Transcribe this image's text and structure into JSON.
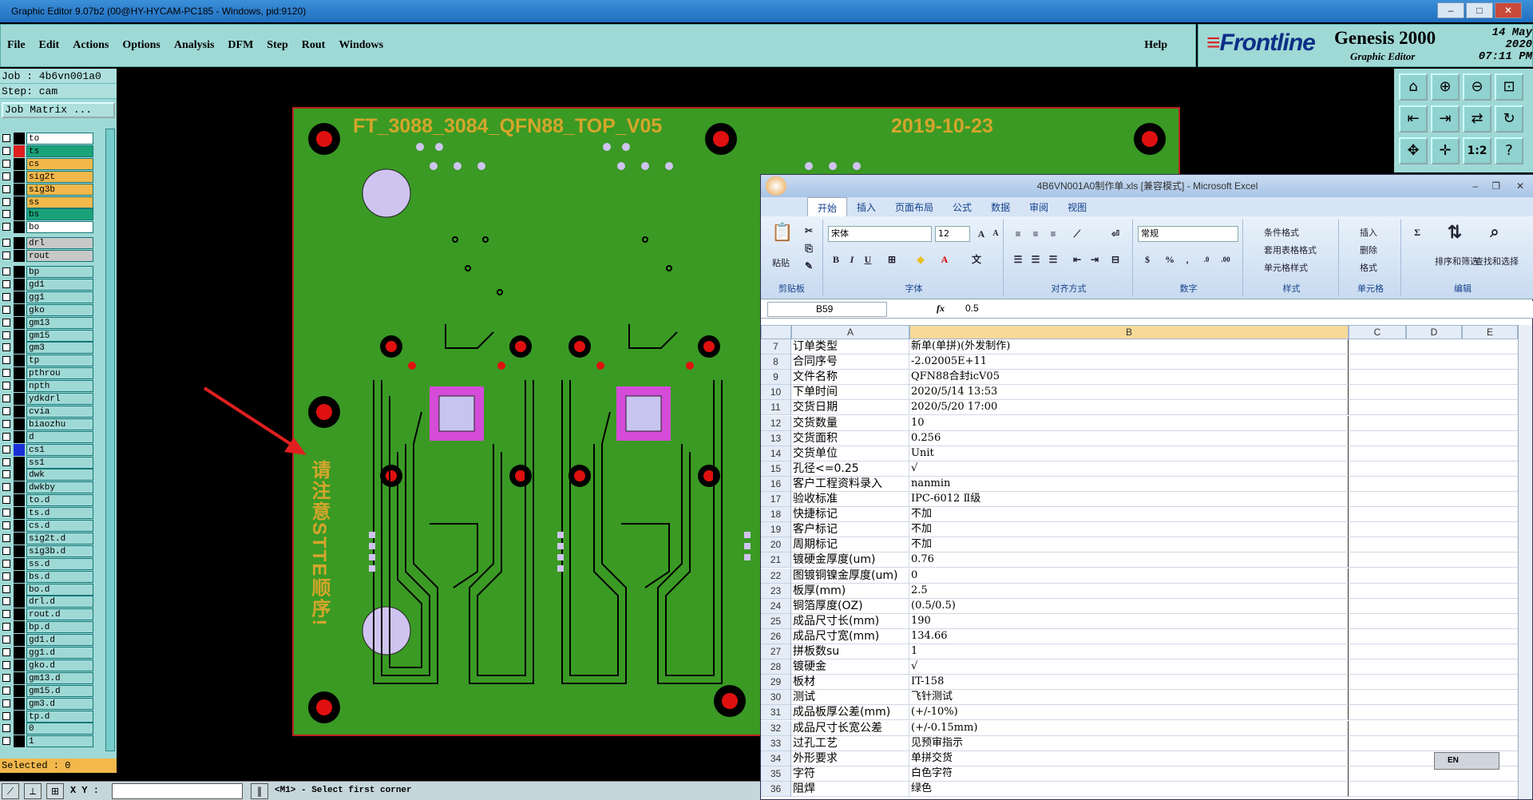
{
  "window_title": "Graphic Editor 9.07b2 (00@HY-HYCAM-PC185 - Windows, pid:9120)",
  "menu": {
    "items": [
      "File",
      "Edit",
      "Actions",
      "Options",
      "Analysis",
      "DFM",
      "Step",
      "Rout",
      "Windows"
    ],
    "help": "Help"
  },
  "brand": {
    "logo": "Frontline",
    "product": "Genesis 2000",
    "subtitle": "Graphic Editor",
    "date": "14 May 2020",
    "time": "07:11 PM"
  },
  "left": {
    "job": "Job : 4b6vn001a0",
    "step": "Step: cam",
    "job_matrix": "Job Matrix ...",
    "selected": "Selected : 0",
    "layers": [
      {
        "name": "to",
        "color": "#ffffff",
        "swatch": "#000000"
      },
      {
        "name": "ts",
        "color": "#1aa37a",
        "swatch": "#e02020"
      },
      {
        "name": "cs",
        "color": "#f2b84b",
        "swatch": "#000000"
      },
      {
        "name": "sig2t",
        "color": "#f2b84b",
        "swatch": "#000000"
      },
      {
        "name": "sig3b",
        "color": "#f2b84b",
        "swatch": "#000000"
      },
      {
        "name": "ss",
        "color": "#f2b84b",
        "swatch": "#000000"
      },
      {
        "name": "bs",
        "color": "#1aa37a",
        "swatch": "#000000"
      },
      {
        "name": "bo",
        "color": "#ffffff",
        "swatch": "#000000"
      },
      {
        "name": "drl",
        "color": "#c8c8c8",
        "swatch": "#000000"
      },
      {
        "name": "rout",
        "color": "#c8c8c8",
        "swatch": "#000000"
      },
      {
        "name": "bp",
        "color": "#9fd9d6",
        "swatch": "#000000"
      },
      {
        "name": "gd1",
        "color": "#9fd9d6",
        "swatch": "#000000"
      },
      {
        "name": "gg1",
        "color": "#9fd9d6",
        "swatch": "#000000"
      },
      {
        "name": "gko",
        "color": "#9fd9d6",
        "swatch": "#000000"
      },
      {
        "name": "gm13",
        "color": "#9fd9d6",
        "swatch": "#000000"
      },
      {
        "name": "gm15",
        "color": "#9fd9d6",
        "swatch": "#000000"
      },
      {
        "name": "gm3",
        "color": "#9fd9d6",
        "swatch": "#000000"
      },
      {
        "name": "tp",
        "color": "#9fd9d6",
        "swatch": "#000000"
      },
      {
        "name": "pthrou",
        "color": "#9fd9d6",
        "swatch": "#000000"
      },
      {
        "name": "npth",
        "color": "#9fd9d6",
        "swatch": "#000000"
      },
      {
        "name": "ydkdrl",
        "color": "#9fd9d6",
        "swatch": "#000000"
      },
      {
        "name": "cvia",
        "color": "#9fd9d6",
        "swatch": "#000000"
      },
      {
        "name": "biaozhu",
        "color": "#9fd9d6",
        "swatch": "#000000"
      },
      {
        "name": "d",
        "color": "#9fd9d6",
        "swatch": "#000000"
      },
      {
        "name": "cs1",
        "color": "#9fd9d6",
        "swatch": "#1a2fd8"
      },
      {
        "name": "ss1",
        "color": "#9fd9d6",
        "swatch": "#000000"
      },
      {
        "name": "dwk",
        "color": "#9fd9d6",
        "swatch": "#000000"
      },
      {
        "name": "dwkby",
        "color": "#9fd9d6",
        "swatch": "#000000"
      },
      {
        "name": "to.d",
        "color": "#9fd9d6",
        "swatch": "#000000"
      },
      {
        "name": "ts.d",
        "color": "#9fd9d6",
        "swatch": "#000000"
      },
      {
        "name": "cs.d",
        "color": "#9fd9d6",
        "swatch": "#000000"
      },
      {
        "name": "sig2t.d",
        "color": "#9fd9d6",
        "swatch": "#000000"
      },
      {
        "name": "sig3b.d",
        "color": "#9fd9d6",
        "swatch": "#000000"
      },
      {
        "name": "ss.d",
        "color": "#9fd9d6",
        "swatch": "#000000"
      },
      {
        "name": "bs.d",
        "color": "#9fd9d6",
        "swatch": "#000000"
      },
      {
        "name": "bo.d",
        "color": "#9fd9d6",
        "swatch": "#000000"
      },
      {
        "name": "drl.d",
        "color": "#9fd9d6",
        "swatch": "#000000"
      },
      {
        "name": "rout.d",
        "color": "#9fd9d6",
        "swatch": "#000000"
      },
      {
        "name": "bp.d",
        "color": "#9fd9d6",
        "swatch": "#000000"
      },
      {
        "name": "gd1.d",
        "color": "#9fd9d6",
        "swatch": "#000000"
      },
      {
        "name": "gg1.d",
        "color": "#9fd9d6",
        "swatch": "#000000"
      },
      {
        "name": "gko.d",
        "color": "#9fd9d6",
        "swatch": "#000000"
      },
      {
        "name": "gm13.d",
        "color": "#9fd9d6",
        "swatch": "#000000"
      },
      {
        "name": "gm15.d",
        "color": "#9fd9d6",
        "swatch": "#000000"
      },
      {
        "name": "gm3.d",
        "color": "#9fd9d6",
        "swatch": "#000000"
      },
      {
        "name": "tp.d",
        "color": "#9fd9d6",
        "swatch": "#000000"
      },
      {
        "name": "0",
        "color": "#9fd9d6",
        "swatch": "#000000"
      },
      {
        "name": "1",
        "color": "#9fd9d6",
        "swatch": "#000000"
      }
    ]
  },
  "status": {
    "coord_label": "X Y :",
    "message": "<M1> - Select first corner"
  },
  "pcb": {
    "title_left": "FT_3088_3084_QFN88_TOP_V05",
    "title_right": "2019-10-23",
    "vertical_text": "请注意STTE顺序!",
    "board_color": "#3a9a24"
  },
  "excel": {
    "title": "4B6VN001A0制作单.xls  [兼容模式] - Microsoft Excel",
    "tabs": [
      "开始",
      "插入",
      "页面布局",
      "公式",
      "数据",
      "审阅",
      "视图"
    ],
    "ribbon": {
      "clipboard": "剪贴板",
      "paste": "粘贴",
      "font": "字体",
      "font_name": "宋体",
      "font_size": "12",
      "alignment": "对齐方式",
      "number": "数字",
      "number_format": "常规",
      "styles": "样式",
      "cond_format": "条件格式",
      "table_format": "套用表格格式",
      "cell_style": "单元格样式",
      "cells": "单元格",
      "insert": "插入",
      "delete": "删除",
      "format": "格式",
      "editing": "编辑",
      "sort": "排序和筛选",
      "find": "查找和选择"
    },
    "name_box": "B59",
    "formula_value": "0.5",
    "columns": [
      "A",
      "B",
      "C",
      "D",
      "E"
    ],
    "rows": [
      {
        "n": "7",
        "a": "订单类型",
        "b": "新单(单拼)(外发制作)"
      },
      {
        "n": "8",
        "a": "合同序号",
        "b": "-2.02005E+11"
      },
      {
        "n": "9",
        "a": "文件名称",
        "b": "QFN88合封icV05"
      },
      {
        "n": "10",
        "a": "下单时间",
        "b": "2020/5/14 13:53"
      },
      {
        "n": "11",
        "a": "交货日期",
        "b": "2020/5/20 17:00"
      },
      {
        "n": "12",
        "a": "交货数量",
        "b": "10"
      },
      {
        "n": "13",
        "a": "交货面积",
        "b": "0.256"
      },
      {
        "n": "14",
        "a": "交货单位",
        "b": "Unit"
      },
      {
        "n": "15",
        "a": "孔径<=0.25",
        "b": "√"
      },
      {
        "n": "16",
        "a": "客户工程资料录入",
        "b": "nanmin"
      },
      {
        "n": "17",
        "a": "验收标准",
        "b": "IPC-6012 Ⅱ级"
      },
      {
        "n": "18",
        "a": "快捷标记",
        "b": "不加"
      },
      {
        "n": "19",
        "a": "客户标记",
        "b": "不加"
      },
      {
        "n": "20",
        "a": "周期标记",
        "b": "不加"
      },
      {
        "n": "21",
        "a": "镀硬金厚度(um)",
        "b": "0.76"
      },
      {
        "n": "22",
        "a": "图镀铜镍金厚度(um)",
        "b": "0"
      },
      {
        "n": "23",
        "a": "板厚(mm)",
        "b": "2.5"
      },
      {
        "n": "24",
        "a": "铜箔厚度(OZ)",
        "b": "(0.5/0.5)"
      },
      {
        "n": "25",
        "a": "成品尺寸长(mm)",
        "b": "190"
      },
      {
        "n": "26",
        "a": "成品尺寸宽(mm)",
        "b": "134.66"
      },
      {
        "n": "27",
        "a": "拼板数su",
        "b": "1"
      },
      {
        "n": "28",
        "a": "镀硬金",
        "b": "√"
      },
      {
        "n": "29",
        "a": "板材",
        "b": "IT-158"
      },
      {
        "n": "30",
        "a": "测试",
        "b": "飞针测试"
      },
      {
        "n": "31",
        "a": "成品板厚公差(mm)",
        "b": "(+/-10%)"
      },
      {
        "n": "32",
        "a": "成品尺寸长宽公差",
        "b": "(+/-0.15mm)"
      },
      {
        "n": "33",
        "a": "过孔工艺",
        "b": "见预审指示"
      },
      {
        "n": "34",
        "a": "外形要求",
        "b": "单拼交货"
      },
      {
        "n": "35",
        "a": "字符",
        "b": "白色字符"
      },
      {
        "n": "36",
        "a": "阻焊",
        "b": "绿色"
      }
    ]
  },
  "langbar": "EN"
}
